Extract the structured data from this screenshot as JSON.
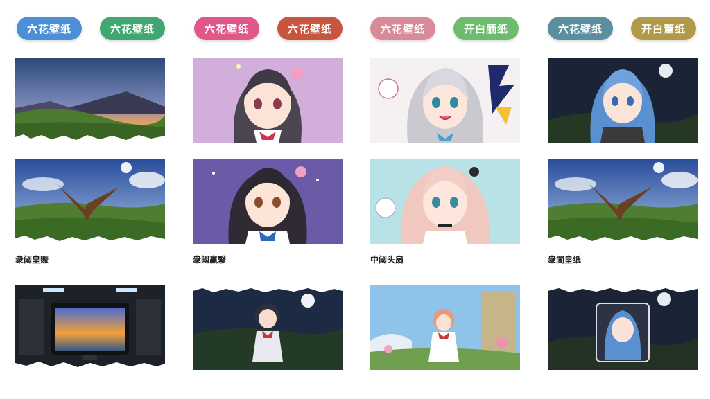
{
  "tabs": [
    {
      "label": "六花壁纸",
      "color": "#4b8fd6"
    },
    {
      "label": "六花壁纸",
      "color": "#3fa76f"
    },
    {
      "label": "六花壁纸",
      "color": "#e0588a"
    },
    {
      "label": "六花壁纸",
      "color": "#c8553d"
    },
    {
      "label": "六花壁纸",
      "color": "#d98a98"
    },
    {
      "label": "开白腼纸",
      "color": "#6dbb6d"
    },
    {
      "label": "六花壁纸",
      "color": "#5b8fa0"
    },
    {
      "label": "开白董纸",
      "color": "#b09a4a"
    }
  ],
  "captions": [
    "衆阈皇赈",
    "衆阈赢繄",
    "中阈头扇",
    "衆閬皇纸"
  ],
  "wallpapers": [
    {
      "subject": "mountain-sunset"
    },
    {
      "subject": "anime-girl-flower-hair"
    },
    {
      "subject": "anime-girl-silver-hair"
    },
    {
      "subject": "anime-girl-blue-hair-night"
    },
    {
      "subject": "eagle-meadow"
    },
    {
      "subject": "anime-girl-dark-hair"
    },
    {
      "subject": "anime-girl-pink-hair"
    },
    {
      "subject": "eagle-meadow"
    },
    {
      "subject": "monitor-room"
    },
    {
      "subject": "anime-girl-night-meadow"
    },
    {
      "subject": "anime-girl-castle-flowers"
    },
    {
      "subject": "framed-portrait-night"
    }
  ]
}
